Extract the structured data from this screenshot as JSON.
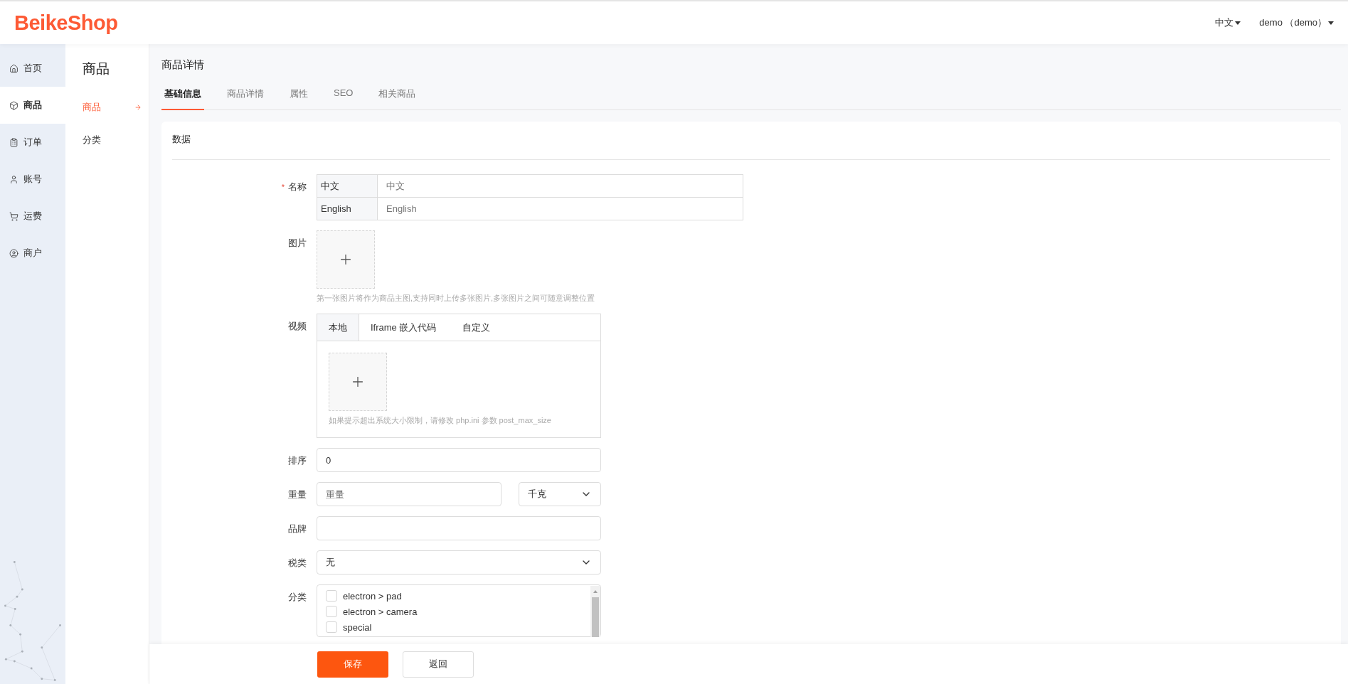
{
  "header": {
    "logo": "BeikeShop",
    "language": "中文",
    "user": "demo （demo）"
  },
  "nav": [
    {
      "label": "首页",
      "selected": false
    },
    {
      "label": "商品",
      "selected": true
    },
    {
      "label": "订单",
      "selected": false
    },
    {
      "label": "账号",
      "selected": false
    },
    {
      "label": "运费",
      "selected": false
    },
    {
      "label": "商户",
      "selected": false
    }
  ],
  "submenu": {
    "title": "商品",
    "items": [
      {
        "label": "商品",
        "selected": true
      },
      {
        "label": "分类",
        "selected": false
      }
    ]
  },
  "page": {
    "title": "商品详情",
    "tabs": [
      {
        "label": "基础信息",
        "selected": true
      },
      {
        "label": "商品详情",
        "selected": false
      },
      {
        "label": "属性",
        "selected": false
      },
      {
        "label": "SEO",
        "selected": false
      },
      {
        "label": "相关商品",
        "selected": false
      }
    ]
  },
  "card": {
    "title": "数据"
  },
  "name": {
    "label": "名称",
    "required_mark": "*",
    "rows": [
      {
        "language": "中文",
        "placeholder": "中文"
      },
      {
        "language": "English",
        "placeholder": "English"
      }
    ]
  },
  "image": {
    "label": "图片",
    "hint": "第一张图片将作为商品主图,支持同时上传多张图片,多张图片之间可随意调整位置"
  },
  "video": {
    "label": "视频",
    "tabs": [
      {
        "label": "本地",
        "selected": true
      },
      {
        "label": "Iframe 嵌入代码",
        "selected": false
      },
      {
        "label": "自定义",
        "selected": false
      }
    ],
    "hint": "如果提示超出系统大小限制，请修改 php.ini 参数 post_max_size"
  },
  "sort": {
    "label": "排序",
    "value": "0"
  },
  "weight": {
    "label": "重量",
    "placeholder": "重量",
    "unit": "千克"
  },
  "brand": {
    "label": "品牌"
  },
  "tax": {
    "label": "税类",
    "value": "无"
  },
  "categories": {
    "label": "分类",
    "items": [
      {
        "label": "electron > pad",
        "checked": false
      },
      {
        "label": "electron > camera",
        "checked": false
      },
      {
        "label": "special",
        "checked": false
      }
    ]
  },
  "buttons": {
    "save": "保存",
    "back": "返回"
  }
}
